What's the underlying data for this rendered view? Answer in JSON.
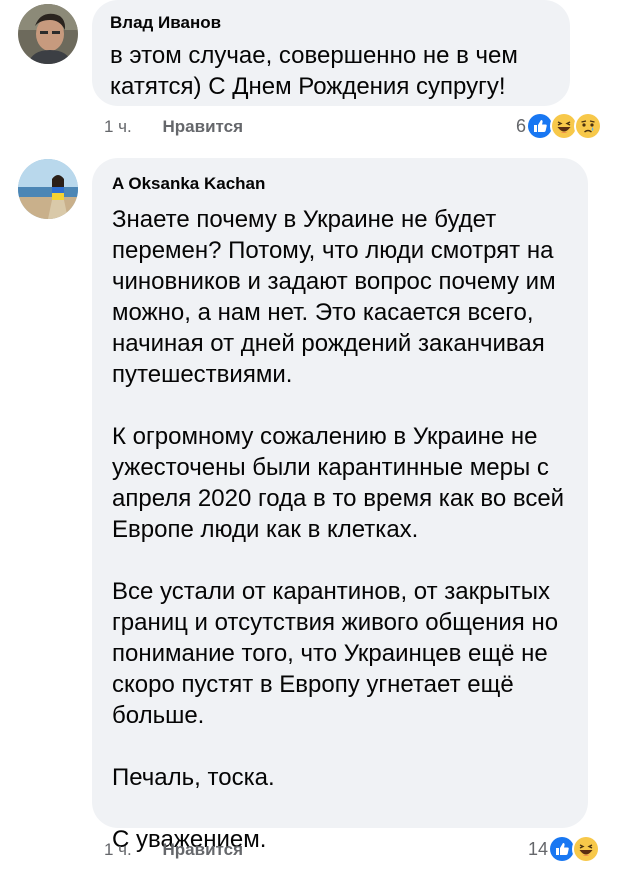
{
  "comments": [
    {
      "author": "Влад Иванов",
      "text": "в этом случае, совершенно не в чем\nкатятся) С Днем Рождения супругу!",
      "time": "1 ч.",
      "like_label": "Нравится",
      "reaction_count": "6",
      "reactions": [
        "like-icon",
        "laugh-icon",
        "sad-icon"
      ]
    },
    {
      "author": "A Oksanka Kachan",
      "paragraphs": [
        "Знаете почему в Украине не будет\nперемен? Потому, что люди смотрят на\nчиновников и задают вопрос почему им\nможно, а нам нет. Это касается всего,\nначиная от дней рождений заканчивая\nпутешествиями.",
        "К огромному сожалению в Украине не\nужесточены были карантинные меры с\nапреля 2020 года в то время как во всей\nЕвропе люди как в клетках.",
        "Все устали от карантинов, от закрытых\nграниц и отсутствия живого общения но\nпонимание того, что Украинцев ещё не\nскоро пустят в Европу угнетает ещё\nбольше.",
        "Печаль, тоска.",
        "С уважением."
      ],
      "time": "1 ч.",
      "like_label": "Нравится",
      "reaction_count": "14",
      "reactions": [
        "like-icon",
        "laugh-icon"
      ]
    }
  ],
  "colors": {
    "bubble": "#f0f2f5",
    "meta_text": "#65676b",
    "like_blue": "#1877f2",
    "emoji_yellow": "#f7c84a"
  }
}
